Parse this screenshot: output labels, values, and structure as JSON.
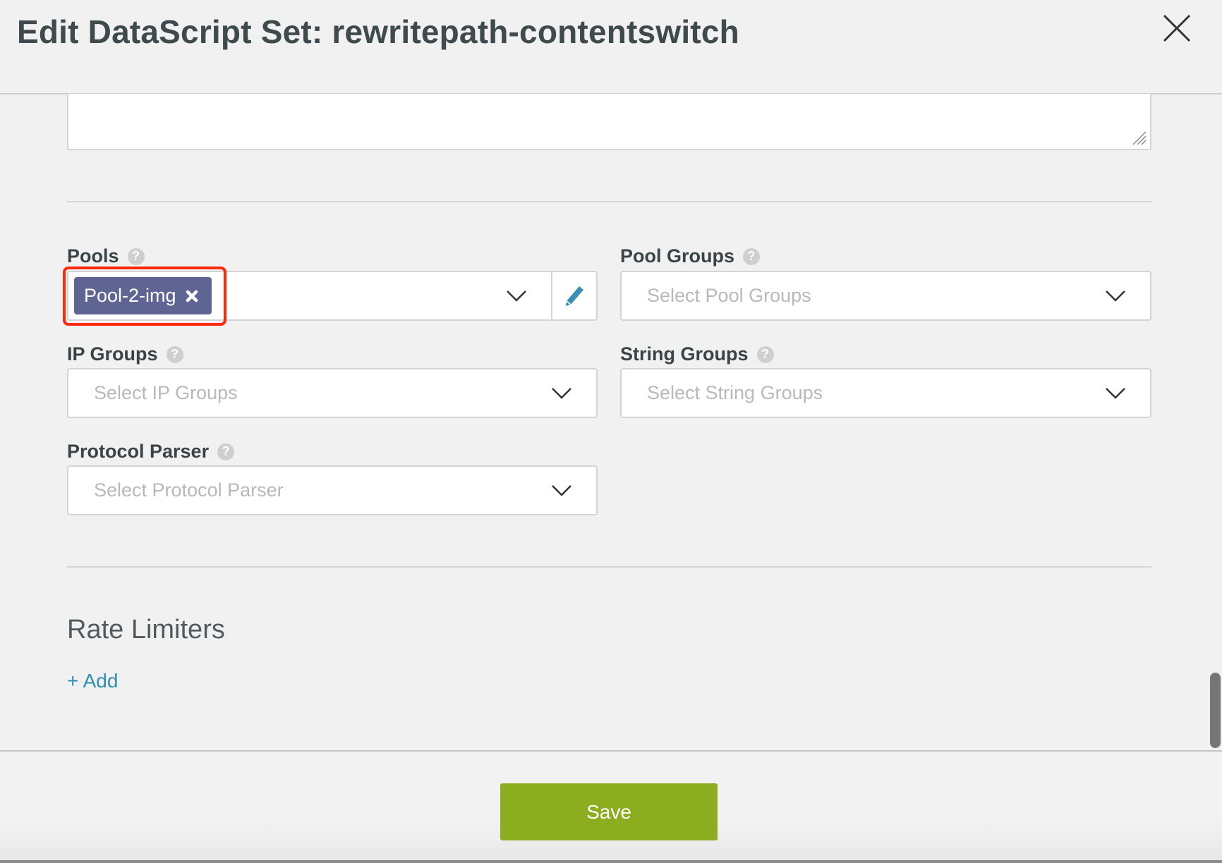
{
  "header": {
    "title": "Edit DataScript Set: rewritepath-contentswitch",
    "close_icon": "close-icon"
  },
  "fields": {
    "pools": {
      "label": "Pools",
      "selected": [
        "Pool-2-img"
      ],
      "highlighted": true
    },
    "pool_groups": {
      "label": "Pool Groups",
      "placeholder": "Select Pool Groups"
    },
    "ip_groups": {
      "label": "IP Groups",
      "placeholder": "Select IP Groups"
    },
    "string_groups": {
      "label": "String Groups",
      "placeholder": "Select String Groups"
    },
    "protocol_parser": {
      "label": "Protocol Parser",
      "placeholder": "Select Protocol Parser"
    }
  },
  "help_glyph": "?",
  "rate_limiters": {
    "heading": "Rate Limiters",
    "add_label": "+ Add"
  },
  "footer": {
    "save_label": "Save"
  },
  "colors": {
    "tag": "#5f6592",
    "highlight": "#ff2a0a",
    "save": "#8cad1f",
    "link": "#2f8fb1"
  }
}
